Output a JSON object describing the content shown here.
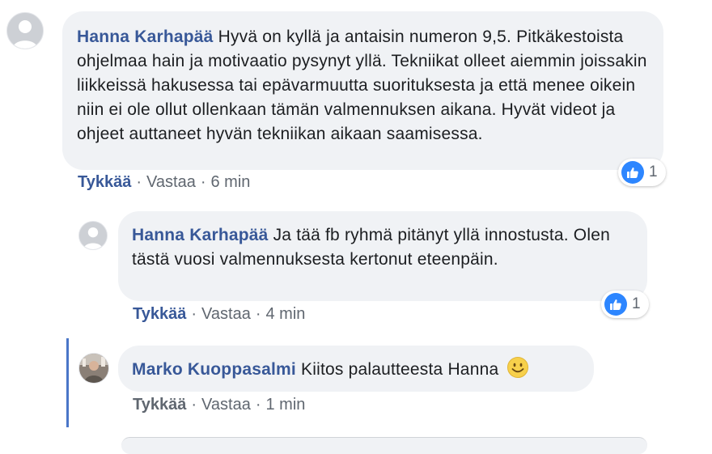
{
  "comments": [
    {
      "author": "Hanna Karhapää",
      "text": "Hyvä on kyllä ja antaisin numeron 9,5. Pitkäkestoista ohjelmaa hain ja motivaatio pysynyt yllä. Tekniikat olleet aiemmin joissakin liikkeissä hakusessa tai epävarmuutta suorituksesta ja että menee oikein niin ei ole ollut ollenkaan tämän valmennuksen aikana. Hyvät videot ja ohjeet auttaneet hyvän tekniikan aikaan saamisessa.",
      "like_label": "Tykkää",
      "reply_label": "Vastaa",
      "time": "6 min",
      "reaction_count": "1",
      "reaction_icon": "like-icon",
      "avatar": "default-avatar"
    },
    {
      "author": "Hanna Karhapää",
      "text": "Ja tää fb ryhmä pitänyt yllä innostusta. Olen tästä vuosi valmennuksesta kertonut eteenpäin.",
      "like_label": "Tykkää",
      "reply_label": "Vastaa",
      "time": "4 min",
      "reaction_count": "1",
      "reaction_icon": "like-icon",
      "avatar": "default-avatar"
    },
    {
      "author": "Marko Kuoppasalmi",
      "text": "Kiitos palautteesta Hanna",
      "emoji": "smiley-emoji",
      "like_label": "Tykkää",
      "reply_label": "Vastaa",
      "time": "1 min",
      "avatar": "profile-photo"
    }
  ],
  "colors": {
    "author": "#385898",
    "bubble": "#f0f2f5",
    "like_blue": "#2d86ff",
    "thread_line": "#4a76c8"
  }
}
